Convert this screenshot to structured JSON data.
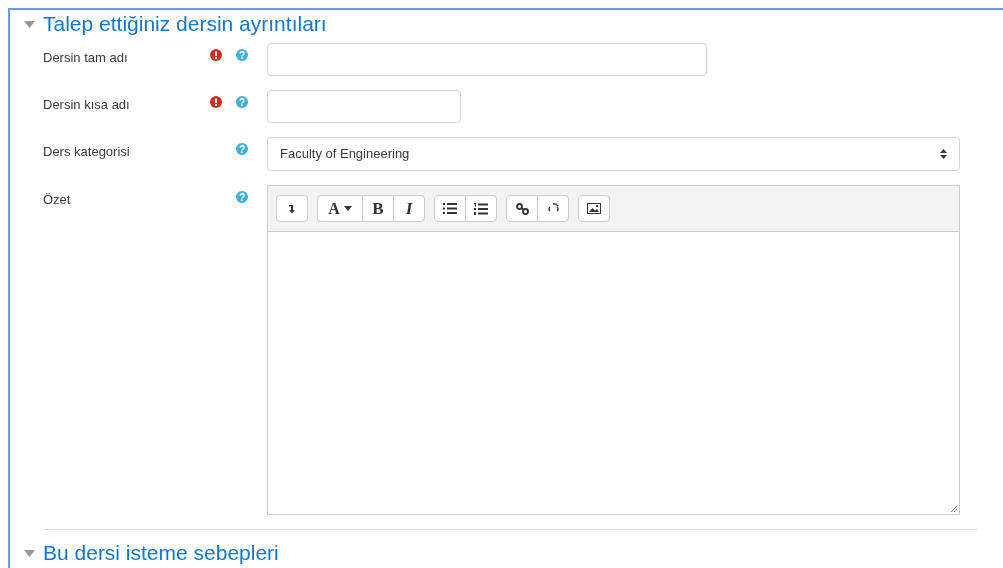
{
  "sections": [
    {
      "title": "Talep ettiğiniz dersin ayrıntıları",
      "expanded": true,
      "fields": [
        {
          "label": "Dersin tam adı",
          "kind": "text",
          "required": true
        },
        {
          "label": "Dersin kısa adı",
          "kind": "shorttext",
          "required": true
        },
        {
          "label": "Ders kategorisi",
          "kind": "select",
          "required": false,
          "value": "Faculty of Engineering"
        },
        {
          "label": "Özet",
          "kind": "editor",
          "required": false,
          "toolbar": [
            [
              {
                "kind": "expand"
              }
            ],
            [
              {
                "kind": "font",
                "text": "A"
              },
              {
                "kind": "bold",
                "text": "B"
              },
              {
                "kind": "italic",
                "text": "I"
              }
            ],
            [
              {
                "kind": "bullets"
              },
              {
                "kind": "numbers"
              }
            ],
            [
              {
                "kind": "link"
              },
              {
                "kind": "unlink"
              }
            ],
            [
              {
                "kind": "image"
              }
            ]
          ]
        }
      ]
    },
    {
      "title": "Bu dersi isteme sebepleri",
      "expanded": true
    }
  ]
}
